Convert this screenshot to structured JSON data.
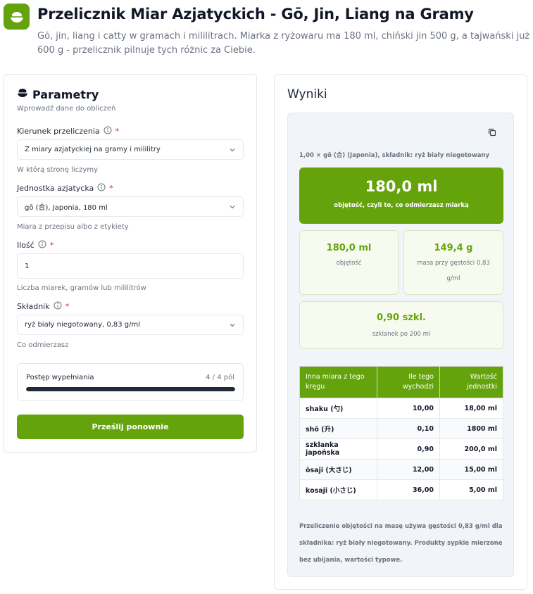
{
  "header": {
    "title": "Przelicznik Miar Azjatyckich - Gō, Jin, Liang na Gramy",
    "subtitle": "Gō, jin, liang i catty w gramach i mililitrach. Miarka z ryżowaru ma 180 ml, chiński jin 500 g, a tajwański już 600 g - przelicznik pilnuje tych różnic za Ciebie."
  },
  "params": {
    "title": "Parametry",
    "subtitle": "Wprowadź dane do obliczeń",
    "direction": {
      "label": "Kierunek przeliczenia",
      "value": "Z miary azjatyckiej na gramy i mililitry",
      "hint": "W którą stronę liczymy"
    },
    "unit": {
      "label": "Jednostka azjatycka",
      "value": "gō (合), Japonia, 180 ml",
      "hint": "Miara z przepisu albo z etykiety"
    },
    "amount": {
      "label": "Ilość",
      "value": "1",
      "hint": "Liczba miarek, gramów lub mililitrów"
    },
    "ingredient": {
      "label": "Składnik",
      "value": "ryż biały niegotowany, 0,83 g/ml",
      "hint": "Co odmierzasz"
    },
    "progress": {
      "label": "Postęp wypełniania",
      "count": "4 / 4 pól",
      "fraction": 1.0
    },
    "submit_label": "Prześlij ponownie"
  },
  "results": {
    "title": "Wyniki",
    "meta": "1,00 × gō (合) (Japonia), składnik: ryż biały niegotowany",
    "hero": {
      "value": "180,0 ml",
      "label": "objętość, czyli to, co odmierzasz miarką"
    },
    "tiles": [
      {
        "value": "180,0 ml",
        "label": "objętość"
      },
      {
        "value": "149,4 g",
        "label": "masa przy gęstości 0,83 g/ml"
      },
      {
        "value": "0,90 szkl.",
        "label": "szklanek po 200 ml"
      }
    ],
    "table": {
      "headers": [
        "Inna miara z tego kręgu",
        "Ile tego wychodzi",
        "Wartość jednostki"
      ],
      "rows": [
        [
          "shaku (勺)",
          "10,00",
          "18,00 ml"
        ],
        [
          "shō (升)",
          "0,10",
          "1800 ml"
        ],
        [
          "szklanka japońska",
          "0,90",
          "200,0 ml"
        ],
        [
          "ōsaji (大さじ)",
          "12,00",
          "15,00 ml"
        ],
        [
          "kosaji (小さじ)",
          "36,00",
          "5,00 ml"
        ]
      ]
    },
    "footnote": "Przeliczenie objętości na masę używa gęstości 0,83 g/ml dla składnika: ryż biały niegotowany. Produkty sypkie mierzone bez ubijania, wartości typowe."
  },
  "colors": {
    "accent": "#65a30d",
    "progress": "#1f2937",
    "required": "#dc2626"
  },
  "icons": [
    "rice-bowl-icon",
    "info-icon",
    "chevron-down-icon",
    "copy-icon"
  ]
}
